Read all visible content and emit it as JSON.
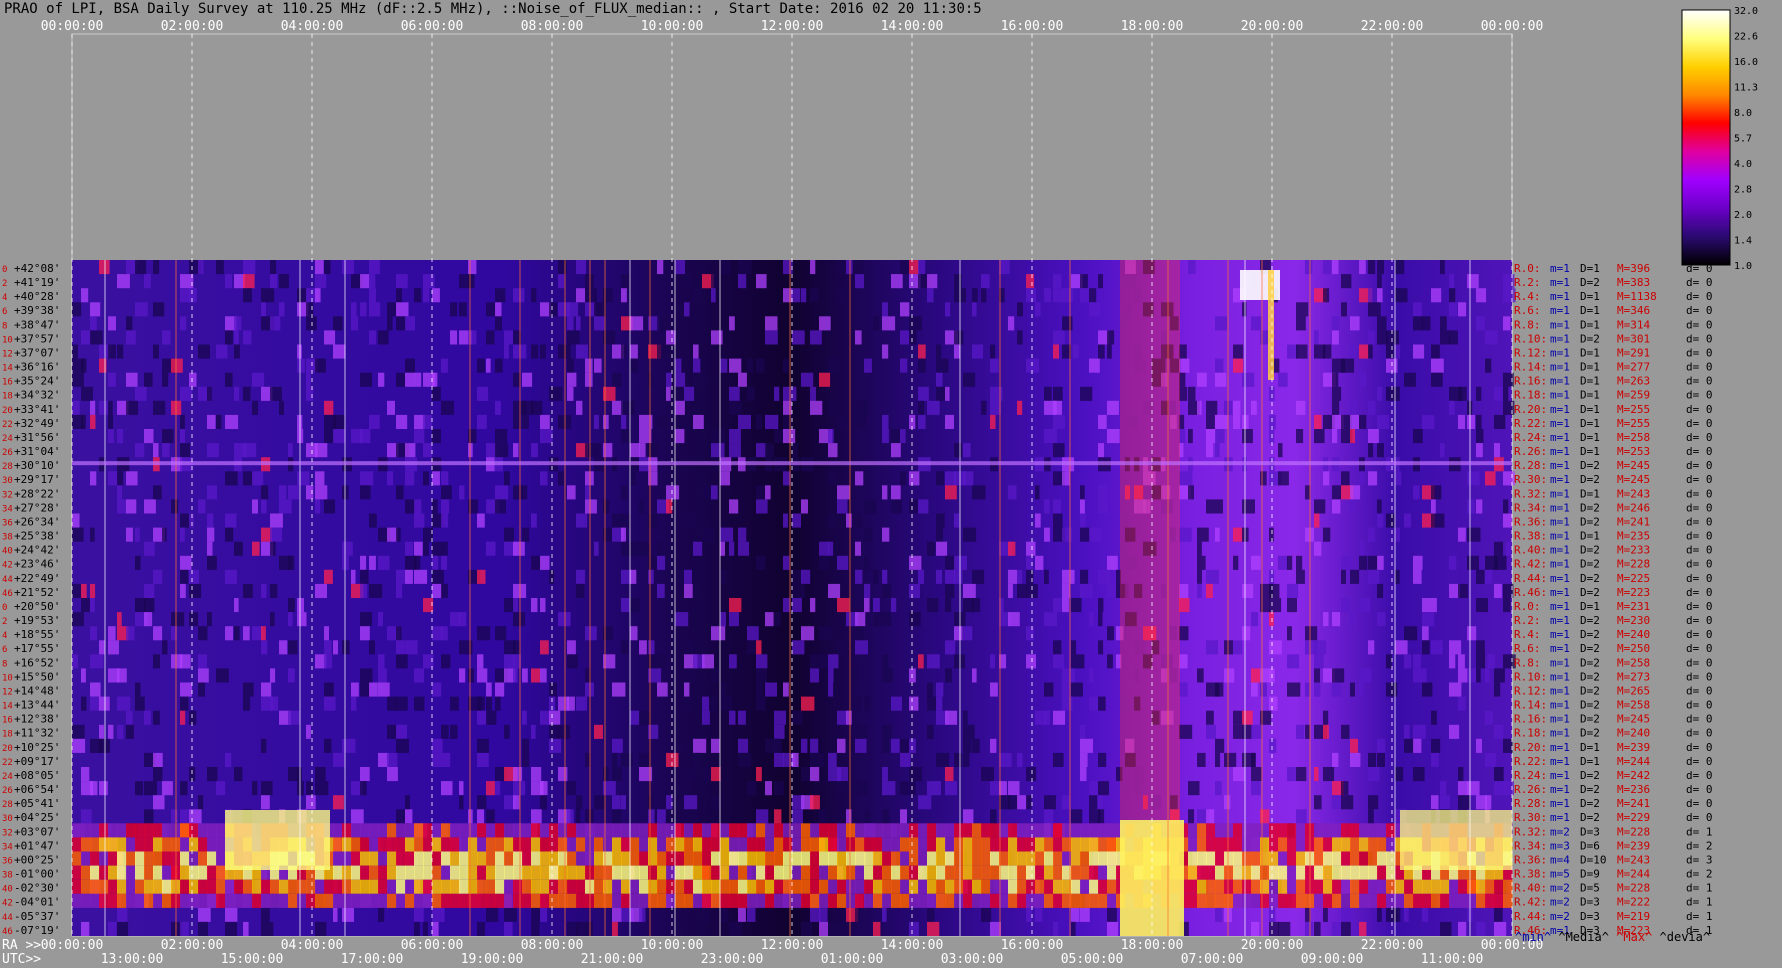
{
  "header": {
    "title": "PRAO of LPI, BSA Daily Survey at 110.25 MHz (dF::2.5 MHz), ::Noise_of_FLUX_median:: , Start Date: 2016 02 20 11:30:5"
  },
  "axis": {
    "ra_prefix": "RA >>",
    "utc_prefix": "UTC>>",
    "top_ticks": [
      "00:00:00",
      "02:00:00",
      "04:00:00",
      "06:00:00",
      "08:00:00",
      "10:00:00",
      "12:00:00",
      "14:00:00",
      "16:00:00",
      "18:00:00",
      "20:00:00",
      "22:00:00",
      "00:00:00"
    ],
    "ra_ticks": [
      "00:00:00",
      "02:00:00",
      "04:00:00",
      "06:00:00",
      "08:00:00",
      "10:00:00",
      "12:00:00",
      "14:00:00",
      "16:00:00",
      "18:00:00",
      "20:00:00",
      "22:00:00",
      "00:00:00"
    ],
    "utc_ticks": [
      "13:00:00",
      "15:00:00",
      "17:00:00",
      "19:00:00",
      "21:00:00",
      "23:00:00",
      "01:00:00",
      "03:00:00",
      "05:00:00",
      "07:00:00",
      "09:00:00",
      "11:00:00"
    ]
  },
  "legend_header": {
    "min": "^min^",
    "median": "^Media^",
    "max": "^Max^",
    "dev": "^devia^"
  },
  "chart_data": {
    "type": "heatmap",
    "colorbar": {
      "ticks": [
        "32.0",
        "22.6",
        "16.0",
        "11.3",
        "8.0",
        "5.7",
        "4.0",
        "2.8",
        "2.0",
        "1.4",
        "1.0"
      ],
      "colors": [
        "#000000",
        "#2a0a70",
        "#6b00c8",
        "#a000ff",
        "#e000a0",
        "#ff0000",
        "#ff8800",
        "#ffd000",
        "#ffff80",
        "#ffffff"
      ]
    },
    "rows": [
      {
        "n": "0",
        "dec": "+42°08'",
        "stat": "R.0:",
        "m": "1",
        "D": "1",
        "M": "396",
        "d": "0"
      },
      {
        "n": "2",
        "dec": "+41°19'",
        "stat": "R.2:",
        "m": "1",
        "D": "2",
        "M": "383",
        "d": "0"
      },
      {
        "n": "4",
        "dec": "+40°28'",
        "stat": "R.4:",
        "m": "1",
        "D": "1",
        "M": "1138",
        "d": "0"
      },
      {
        "n": "6",
        "dec": "+39°38'",
        "stat": "R.6:",
        "m": "1",
        "D": "1",
        "M": "346",
        "d": "0"
      },
      {
        "n": "8",
        "dec": "+38°47'",
        "stat": "R.8:",
        "m": "1",
        "D": "1",
        "M": "314",
        "d": "0"
      },
      {
        "n": "10",
        "dec": "+37°57'",
        "stat": "R.10:",
        "m": "1",
        "D": "2",
        "M": "301",
        "d": "0"
      },
      {
        "n": "12",
        "dec": "+37°07'",
        "stat": "R.12:",
        "m": "1",
        "D": "1",
        "M": "291",
        "d": "0"
      },
      {
        "n": "14",
        "dec": "+36°16'",
        "stat": "R.14:",
        "m": "1",
        "D": "1",
        "M": "277",
        "d": "0"
      },
      {
        "n": "16",
        "dec": "+35°24'",
        "stat": "R.16:",
        "m": "1",
        "D": "1",
        "M": "263",
        "d": "0"
      },
      {
        "n": "18",
        "dec": "+34°32'",
        "stat": "R.18:",
        "m": "1",
        "D": "1",
        "M": "259",
        "d": "0"
      },
      {
        "n": "20",
        "dec": "+33°41'",
        "stat": "R.20:",
        "m": "1",
        "D": "1",
        "M": "255",
        "d": "0"
      },
      {
        "n": "22",
        "dec": "+32°49'",
        "stat": "R.22:",
        "m": "1",
        "D": "1",
        "M": "255",
        "d": "0"
      },
      {
        "n": "24",
        "dec": "+31°56'",
        "stat": "R.24:",
        "m": "1",
        "D": "1",
        "M": "258",
        "d": "0"
      },
      {
        "n": "26",
        "dec": "+31°04'",
        "stat": "R.26:",
        "m": "1",
        "D": "1",
        "M": "253",
        "d": "0"
      },
      {
        "n": "28",
        "dec": "+30°10'",
        "stat": "R.28:",
        "m": "1",
        "D": "2",
        "M": "245",
        "d": "0"
      },
      {
        "n": "30",
        "dec": "+29°17'",
        "stat": "R.30:",
        "m": "1",
        "D": "2",
        "M": "245",
        "d": "0"
      },
      {
        "n": "32",
        "dec": "+28°22'",
        "stat": "R.32:",
        "m": "1",
        "D": "1",
        "M": "243",
        "d": "0"
      },
      {
        "n": "34",
        "dec": "+27°28'",
        "stat": "R.34:",
        "m": "1",
        "D": "2",
        "M": "246",
        "d": "0"
      },
      {
        "n": "36",
        "dec": "+26°34'",
        "stat": "R.36:",
        "m": "1",
        "D": "2",
        "M": "241",
        "d": "0"
      },
      {
        "n": "38",
        "dec": "+25°38'",
        "stat": "R.38:",
        "m": "1",
        "D": "1",
        "M": "235",
        "d": "0"
      },
      {
        "n": "40",
        "dec": "+24°42'",
        "stat": "R.40:",
        "m": "1",
        "D": "2",
        "M": "233",
        "d": "0"
      },
      {
        "n": "42",
        "dec": "+23°46'",
        "stat": "R.42:",
        "m": "1",
        "D": "2",
        "M": "228",
        "d": "0"
      },
      {
        "n": "44",
        "dec": "+22°49'",
        "stat": "R.44:",
        "m": "1",
        "D": "2",
        "M": "225",
        "d": "0"
      },
      {
        "n": "46",
        "dec": "+21°52'",
        "stat": "R.46:",
        "m": "1",
        "D": "2",
        "M": "223",
        "d": "0"
      },
      {
        "n": "0",
        "dec": "+20°50'",
        "stat": "R.0:",
        "m": "1",
        "D": "1",
        "M": "231",
        "d": "0"
      },
      {
        "n": "2",
        "dec": "+19°53'",
        "stat": "R.2:",
        "m": "1",
        "D": "2",
        "M": "230",
        "d": "0"
      },
      {
        "n": "4",
        "dec": "+18°55'",
        "stat": "R.4:",
        "m": "1",
        "D": "2",
        "M": "240",
        "d": "0"
      },
      {
        "n": "6",
        "dec": "+17°55'",
        "stat": "R.6:",
        "m": "1",
        "D": "2",
        "M": "250",
        "d": "0"
      },
      {
        "n": "8",
        "dec": "+16°52'",
        "stat": "R.8:",
        "m": "1",
        "D": "2",
        "M": "258",
        "d": "0"
      },
      {
        "n": "10",
        "dec": "+15°50'",
        "stat": "R.10:",
        "m": "1",
        "D": "2",
        "M": "273",
        "d": "0"
      },
      {
        "n": "12",
        "dec": "+14°48'",
        "stat": "R.12:",
        "m": "1",
        "D": "2",
        "M": "265",
        "d": "0"
      },
      {
        "n": "14",
        "dec": "+13°44'",
        "stat": "R.14:",
        "m": "1",
        "D": "2",
        "M": "258",
        "d": "0"
      },
      {
        "n": "16",
        "dec": "+12°38'",
        "stat": "R.16:",
        "m": "1",
        "D": "2",
        "M": "245",
        "d": "0"
      },
      {
        "n": "18",
        "dec": "+11°32'",
        "stat": "R.18:",
        "m": "1",
        "D": "2",
        "M": "240",
        "d": "0"
      },
      {
        "n": "20",
        "dec": "+10°25'",
        "stat": "R.20:",
        "m": "1",
        "D": "1",
        "M": "239",
        "d": "0"
      },
      {
        "n": "22",
        "dec": "+09°17'",
        "stat": "R.22:",
        "m": "1",
        "D": "1",
        "M": "244",
        "d": "0"
      },
      {
        "n": "24",
        "dec": "+08°05'",
        "stat": "R.24:",
        "m": "1",
        "D": "2",
        "M": "242",
        "d": "0"
      },
      {
        "n": "26",
        "dec": "+06°54'",
        "stat": "R.26:",
        "m": "1",
        "D": "2",
        "M": "236",
        "d": "0"
      },
      {
        "n": "28",
        "dec": "+05°41'",
        "stat": "R.28:",
        "m": "1",
        "D": "2",
        "M": "241",
        "d": "0"
      },
      {
        "n": "30",
        "dec": "+04°25'",
        "stat": "R.30:",
        "m": "1",
        "D": "2",
        "M": "229",
        "d": "0"
      },
      {
        "n": "32",
        "dec": "+03°07'",
        "stat": "R.32:",
        "m": "2",
        "D": "3",
        "M": "228",
        "d": "1"
      },
      {
        "n": "34",
        "dec": "+01°47'",
        "stat": "R.34:",
        "m": "3",
        "D": "6",
        "M": "239",
        "d": "2"
      },
      {
        "n": "36",
        "dec": "+00°25'",
        "stat": "R.36:",
        "m": "4",
        "D": "10",
        "M": "243",
        "d": "3"
      },
      {
        "n": "38",
        "dec": "-01°00'",
        "stat": "R.38:",
        "m": "5",
        "D": "9",
        "M": "244",
        "d": "2"
      },
      {
        "n": "40",
        "dec": "-02°30'",
        "stat": "R.40:",
        "m": "2",
        "D": "5",
        "M": "228",
        "d": "1"
      },
      {
        "n": "42",
        "dec": "-04°01'",
        "stat": "R.42:",
        "m": "2",
        "D": "3",
        "M": "222",
        "d": "1"
      },
      {
        "n": "44",
        "dec": "-05°37'",
        "stat": "R.44:",
        "m": "2",
        "D": "3",
        "M": "219",
        "d": "1"
      },
      {
        "n": "46",
        "dec": "-07°19'",
        "stat": "R.46:",
        "m": "1",
        "D": "3",
        "M": "223",
        "d": "1"
      }
    ]
  }
}
